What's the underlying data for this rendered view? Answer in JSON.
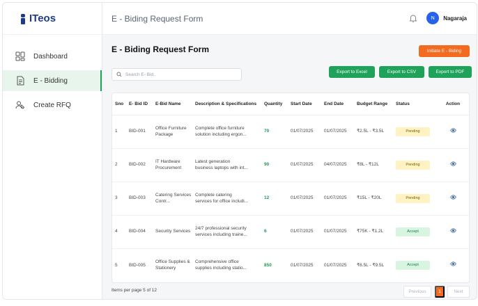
{
  "brand": {
    "name": "ITeos"
  },
  "sidebar": {
    "items": [
      {
        "label": "Dashboard",
        "icon": "dashboard-icon"
      },
      {
        "label": "E - Bidding",
        "icon": "document-icon",
        "active": true
      },
      {
        "label": "Create RFQ",
        "icon": "create-rfq-icon"
      }
    ]
  },
  "header": {
    "title": "E - Biding Request Form",
    "user": {
      "initial": "N",
      "name": "Nagaraja"
    }
  },
  "main": {
    "title": "E - Biding Request Form",
    "initiate_label": "Initiate E - Biding",
    "search_placeholder": "Search E- Bid..",
    "export": {
      "excel": "Export to Excel",
      "csv": "Export to CSV",
      "pdf": "Export to PDF"
    },
    "columns": [
      "Sno",
      "E- Bid ID",
      "E-Bid Name",
      "Description & Specifications",
      "Quantity",
      "Start Date",
      "End Date",
      "Budget Range",
      "Status",
      "Action"
    ],
    "rows": [
      {
        "sno": "1",
        "id": "BID-001",
        "name": "Office Furniture Package",
        "desc1": "Complete office furniture",
        "desc2": "solution including ergon...",
        "qty": "70",
        "start": "01/07/2025",
        "end": "01/07/2025",
        "budget": "₹2.5L - ₹3.5L",
        "status": "Pending"
      },
      {
        "sno": "2",
        "id": "BID-002",
        "name": "IT Hardware Procurement",
        "desc1": "Latest generation",
        "desc2": "business laptops with int...",
        "qty": "90",
        "start": "01/07/2025",
        "end": "04/07/2025",
        "budget": "₹8L - ₹12L",
        "status": "Pending"
      },
      {
        "sno": "3",
        "id": "BID-003",
        "name": "Catering Services Contr...",
        "desc1": "Complete catering",
        "desc2": "services for office includi...",
        "qty": "12",
        "start": "01/07/2025",
        "end": "01/07/2025",
        "budget": "₹15L - ₹20L",
        "status": "Pending"
      },
      {
        "sno": "4",
        "id": "BID-004",
        "name": "Security Services",
        "desc1": "24/7 professional security",
        "desc2": "services including traine...",
        "qty": "6",
        "start": "01/07/2025",
        "end": "01/07/2025",
        "budget": "₹75K - ₹1.2L",
        "status": "Accept"
      },
      {
        "sno": "5",
        "id": "BID-005",
        "name": "Office Supplies & Stationery",
        "desc1": "Comprehensive office",
        "desc2": "supplies including statio...",
        "qty": "850",
        "start": "01/07/2025",
        "end": "01/07/2025",
        "budget": "₹6.5L - ₹9.5L",
        "status": "Accept"
      }
    ],
    "footer": {
      "items_text": "Items per page 5 of 12",
      "prev": "Previous",
      "page": "1",
      "next": "Next"
    }
  },
  "colors": {
    "accent_orange": "#f26b21",
    "accent_green": "#1fa35a",
    "brand_blue": "#1f3a8a"
  }
}
